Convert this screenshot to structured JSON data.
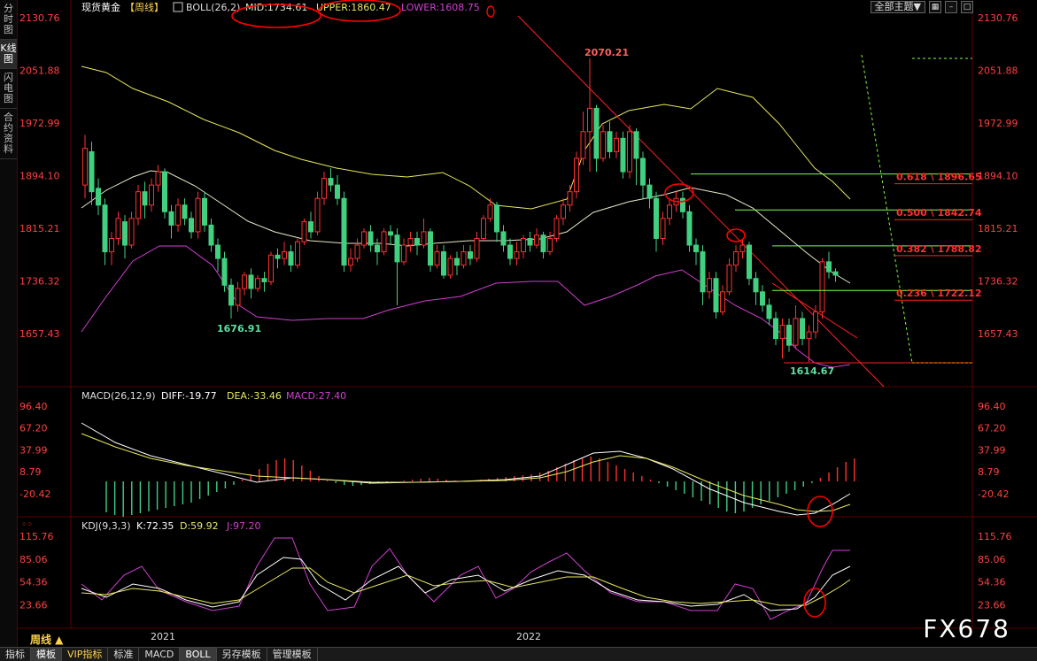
{
  "side_tabs": [
    {
      "label": "分时图",
      "active": false
    },
    {
      "label": "K线图",
      "active": true
    },
    {
      "label": "闪电图",
      "active": false
    },
    {
      "label": "合约资料",
      "active": false
    }
  ],
  "header": {
    "title": "现货黄金",
    "period_tag": "【周线】",
    "boll_label": "BOLL(26,2)",
    "mid": "MID:1734.61",
    "upper": "UPPER:1860.47",
    "lower": "LOWER:1608.75"
  },
  "top_controls": {
    "theme": "全部主题▼"
  },
  "price_axis": [
    "2130.76",
    "2051.88",
    "1972.99",
    "1894.10",
    "1815.21",
    "1736.32",
    "1657.43"
  ],
  "annotations": {
    "high": "2070.21",
    "low1": "1676.91",
    "low2": "1614.67"
  },
  "fib_levels": [
    {
      "label": "0.618 \\ 1896.65",
      "value": 1896.65
    },
    {
      "label": "0.500 \\ 1842.74",
      "value": 1842.74
    },
    {
      "label": "0.382 \\ 1788.82",
      "value": 1788.82
    },
    {
      "label": "0.236 \\ 1722.12",
      "value": 1722.12
    }
  ],
  "macd": {
    "label": "MACD(26,12,9)",
    "diff": "DIFF:-19.77",
    "dea": "DEA:-33.46",
    "macd": "MACD:27.40",
    "axis": [
      "96.40",
      "67.20",
      "37.99",
      "8.79",
      "-20.42"
    ]
  },
  "kdj": {
    "label": "KDJ(9,3,3)",
    "k": "K:72.35",
    "d": "D:59.92",
    "j": "J:97.20",
    "axis": [
      "115.76",
      "85.06",
      "54.36",
      "23.66"
    ]
  },
  "x_axis": [
    "2021",
    "2022"
  ],
  "period_label": "周线 ▲",
  "bottom_tabs": [
    {
      "label": "指标",
      "active": false
    },
    {
      "label": "模板",
      "active": true
    },
    {
      "label": "VIP指标",
      "active": false,
      "vip": true
    },
    {
      "label": "标准",
      "active": false
    },
    {
      "label": "MACD",
      "active": false
    },
    {
      "label": "BOLL",
      "active": true
    },
    {
      "label": "另存模板",
      "active": false
    },
    {
      "label": "管理模板",
      "active": false
    }
  ],
  "watermark": "FX678",
  "colors": {
    "up": "#ff3030",
    "down": "#40d080",
    "mid": "#e8e8c8",
    "upper": "#e8e860",
    "lower": "#d040d0",
    "trend": "#ff2020",
    "fib": "#80ff40"
  }
}
